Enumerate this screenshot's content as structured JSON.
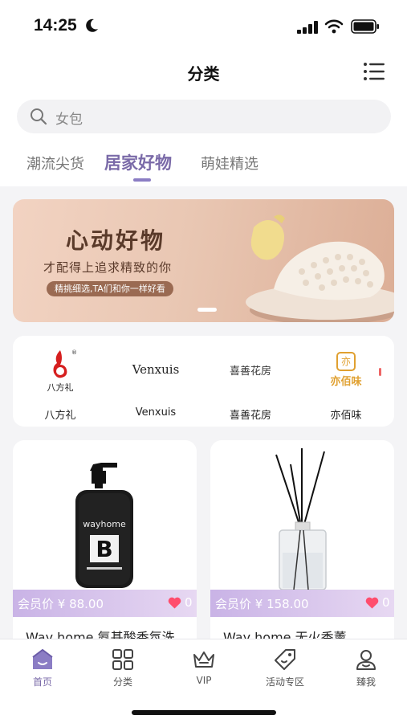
{
  "status_bar": {
    "time": "14:25"
  },
  "header": {
    "title": "分类"
  },
  "search": {
    "placeholder": "女包"
  },
  "tabs": [
    {
      "label": "潮流尖货",
      "active": false
    },
    {
      "label": "居家好物",
      "active": true
    },
    {
      "label": "萌娃精选",
      "active": false
    }
  ],
  "banner": {
    "title": "心动好物",
    "subtitle": "才配得上追求精致的你",
    "tag": "精挑细选,TA们和你一样好看"
  },
  "brands": [
    {
      "name": "八方礼",
      "logo_text": "八方礼"
    },
    {
      "name": "Venxuis",
      "logo_text": "Venxuis"
    },
    {
      "name": "喜善花房",
      "logo_text": "喜善花房"
    },
    {
      "name": "亦佰味",
      "logo_text": "亦佰味"
    }
  ],
  "products": [
    {
      "price": "会员价 ¥ 88.00",
      "likes": "0",
      "name": "Way home 氨基酸香氛洗",
      "bottle_brand": "wayhome",
      "bottle_letter": "B"
    },
    {
      "price": "会员价 ¥ 158.00",
      "likes": "0",
      "name": "Way home 无火香薰"
    }
  ],
  "bottom_nav": [
    {
      "label": "首页",
      "icon": "home-icon",
      "active": true
    },
    {
      "label": "分类",
      "icon": "grid-icon",
      "active": false
    },
    {
      "label": "VIP",
      "icon": "crown-icon",
      "active": false
    },
    {
      "label": "活动专区",
      "icon": "tag-icon",
      "active": false
    },
    {
      "label": "臻我",
      "icon": "user-icon",
      "active": false
    }
  ],
  "colors": {
    "accent": "#7a6aa8",
    "price_bar": "#c9b3e6",
    "heart": "#ff4d6d",
    "background": "#f4f4f6"
  }
}
